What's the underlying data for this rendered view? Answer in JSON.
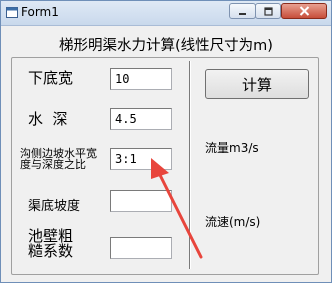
{
  "window": {
    "title": "Form1"
  },
  "heading": "梯形明渠水力计算(线性尺寸为m)",
  "fields": [
    {
      "label": "下底宽",
      "value": "10"
    },
    {
      "label": "水  深",
      "value": "4.5"
    },
    {
      "label": "沟侧边坡水平宽度与深度之比",
      "value": "3:1"
    },
    {
      "label": "渠底坡度",
      "value": ""
    },
    {
      "label": "池壁粗糙系数",
      "value": ""
    }
  ],
  "calc_button": "计算",
  "results": {
    "flow": "流量m3/s",
    "velocity": "流速(m/s)"
  },
  "colors": {
    "arrow": "#e8453c"
  }
}
